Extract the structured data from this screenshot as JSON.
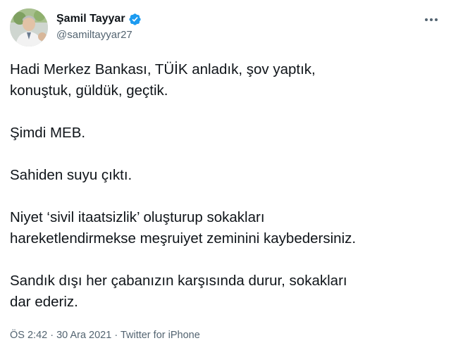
{
  "author": {
    "display_name": "Şamil Tayyar",
    "handle": "@samiltayyar27",
    "verified": true
  },
  "tweet": {
    "paragraphs": [
      "Hadi Merkez Bankası, TÜİK anladık, şov yaptık,\nkonuştuk, güldük, geçtik.",
      "Şimdi MEB.",
      "Sahiden suyu çıktı.",
      "Niyet ‘sivil itaatsizlik’ oluşturup sokakları\nhareketlendirmekse meşruiyet zeminini kaybedersiniz.",
      "Sandık dışı her çabanızın karşısında durur, sokakları\ndar ederiz."
    ],
    "meta": {
      "time": "ÖS 2:42",
      "date": "30 Ara 2021",
      "source": "Twitter for iPhone",
      "separator": " · "
    }
  },
  "icons": {
    "verified": "verified-badge-icon",
    "more": "more-options-icon"
  },
  "colors": {
    "text_primary": "#0f1419",
    "text_secondary": "#536471",
    "verified_blue": "#1d9bf0"
  }
}
